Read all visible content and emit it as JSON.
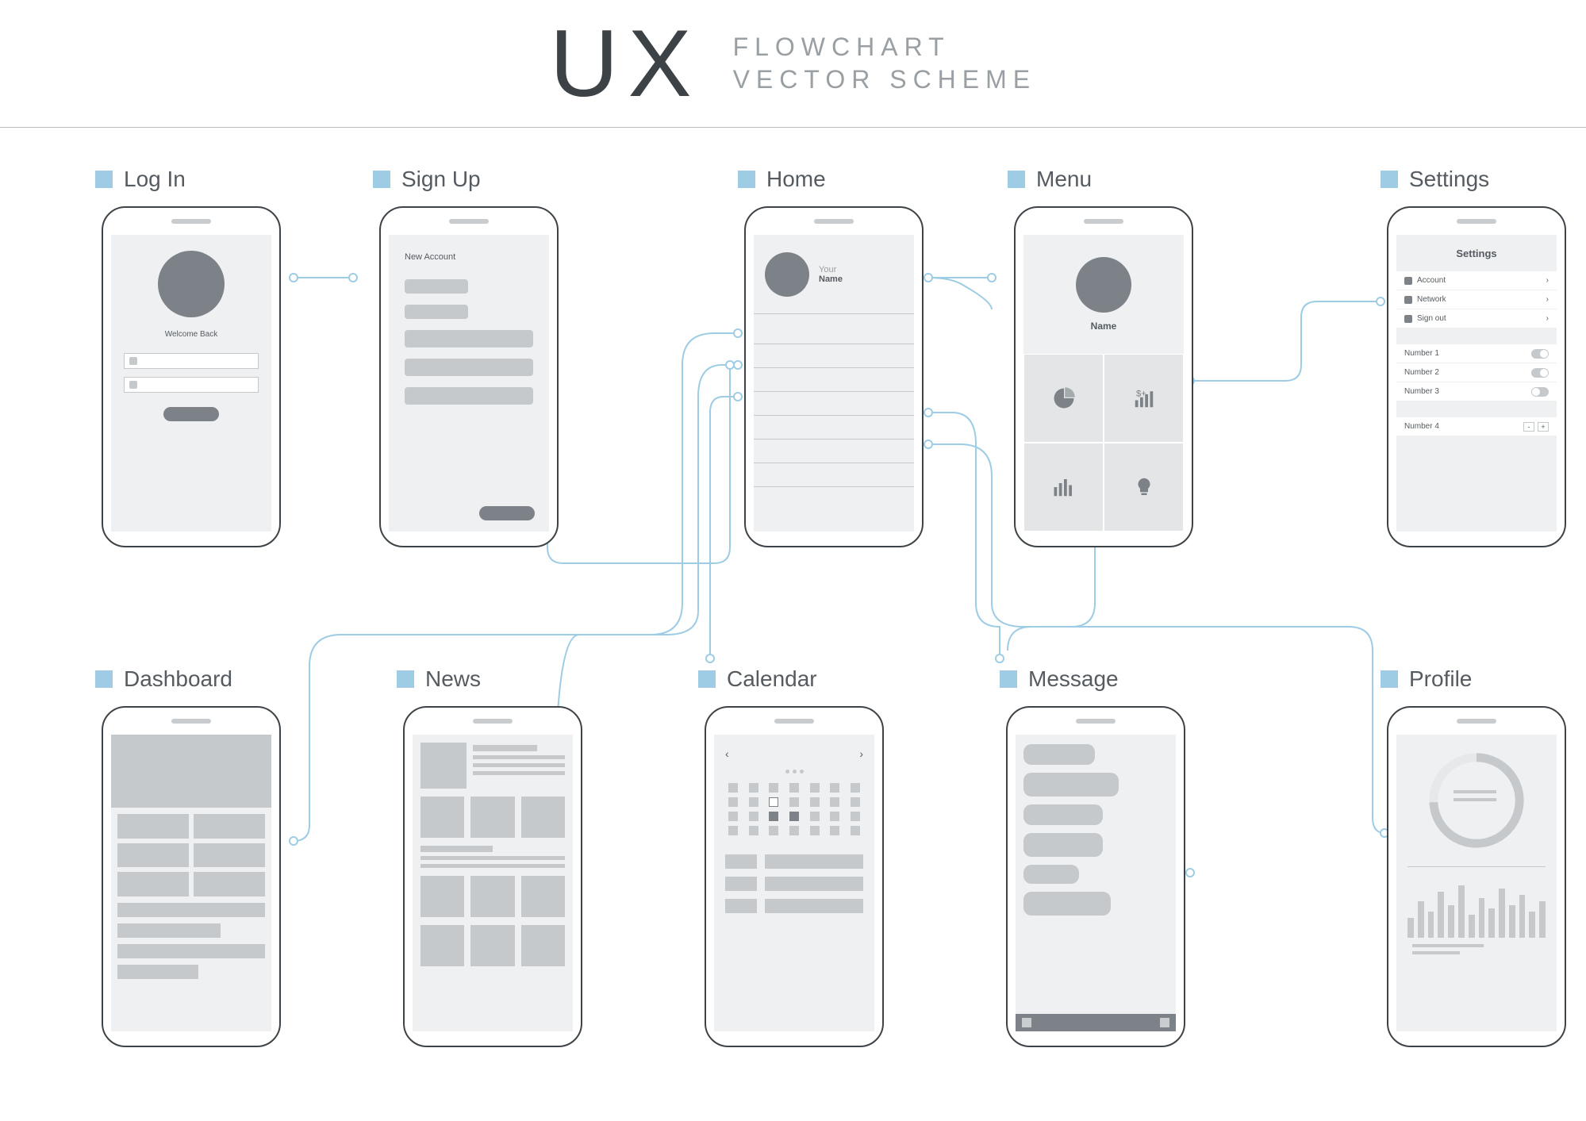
{
  "header": {
    "logo": "UX",
    "title_line1": "FLOWCHART",
    "title_line2": "VECTOR SCHEME"
  },
  "colors": {
    "accent": "#9ecce4",
    "grey_dark": "#7c8287",
    "grey_mid": "#c6c9cb",
    "grey_bg": "#eff0f1"
  },
  "screens": {
    "login": {
      "label": "Log In",
      "welcome": "Welcome Back"
    },
    "signup": {
      "label": "Sign Up",
      "title": "New Account"
    },
    "home": {
      "label": "Home",
      "your": "Your",
      "name": "Name"
    },
    "menu": {
      "label": "Menu",
      "name": "Name",
      "tiles": [
        "pie-icon",
        "stats-dollar-icon",
        "bars-icon",
        "bulb-icon"
      ]
    },
    "settings": {
      "label": "Settings",
      "title": "Settings",
      "links": [
        "Account",
        "Network",
        "Sign out"
      ],
      "toggles": [
        {
          "label": "Number 1",
          "state": "on"
        },
        {
          "label": "Number 2",
          "state": "on"
        },
        {
          "label": "Number 3",
          "state": "off"
        }
      ],
      "stepper": {
        "label": "Number 4"
      }
    },
    "dashboard": {
      "label": "Dashboard"
    },
    "news": {
      "label": "News"
    },
    "calendar": {
      "label": "Calendar"
    },
    "message": {
      "label": "Message"
    },
    "profile": {
      "label": "Profile"
    }
  },
  "flows": [
    {
      "from": "login",
      "to": "signup"
    },
    {
      "from": "signup",
      "to": "home"
    },
    {
      "from": "home",
      "to": "menu"
    },
    {
      "from": "menu",
      "to": "settings"
    },
    {
      "from": "home",
      "to": "dashboard"
    },
    {
      "from": "home",
      "to": "news"
    },
    {
      "from": "home",
      "to": "calendar"
    },
    {
      "from": "home",
      "to": "message"
    },
    {
      "from": "home",
      "to": "profile"
    },
    {
      "from": "menu",
      "to": "message"
    }
  ]
}
